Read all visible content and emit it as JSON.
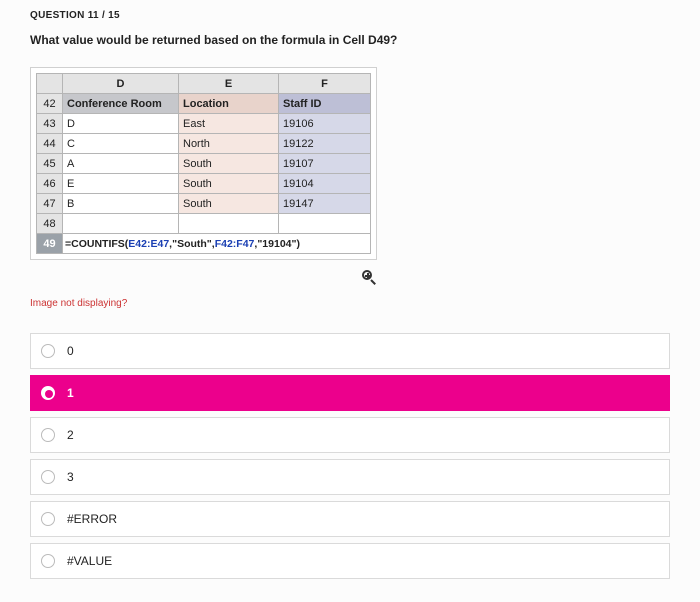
{
  "question_number": "QUESTION 11 / 15",
  "prompt": "What value would be returned based on the formula in Cell D49?",
  "sheet": {
    "col_headers": [
      "D",
      "E",
      "F"
    ],
    "rows": [
      {
        "num": "42",
        "d": "Conference Room",
        "e": "Location",
        "f": "Staff ID",
        "header": true
      },
      {
        "num": "43",
        "d": "D",
        "e": "East",
        "f": "19106"
      },
      {
        "num": "44",
        "d": "C",
        "e": "North",
        "f": "19122"
      },
      {
        "num": "45",
        "d": "A",
        "e": "South",
        "f": "19107"
      },
      {
        "num": "46",
        "d": "E",
        "e": "South",
        "f": "19104"
      },
      {
        "num": "47",
        "d": "B",
        "e": "South",
        "f": "19147"
      },
      {
        "num": "48",
        "d": "",
        "e": "",
        "f": "",
        "blank": true
      }
    ],
    "formula_row": {
      "num": "49",
      "prefix": "=COUNTIFS(",
      "rng1": "E42:E47",
      "mid1": ",\"South\",",
      "rng2": "F42:F47",
      "suffix": ",\"19104\")"
    }
  },
  "image_missing_text": "Image not displaying?",
  "options": [
    {
      "label": "0",
      "selected": false
    },
    {
      "label": "1",
      "selected": true
    },
    {
      "label": "2",
      "selected": false
    },
    {
      "label": "3",
      "selected": false
    },
    {
      "label": "#ERROR",
      "selected": false
    },
    {
      "label": "#VALUE",
      "selected": false
    }
  ]
}
